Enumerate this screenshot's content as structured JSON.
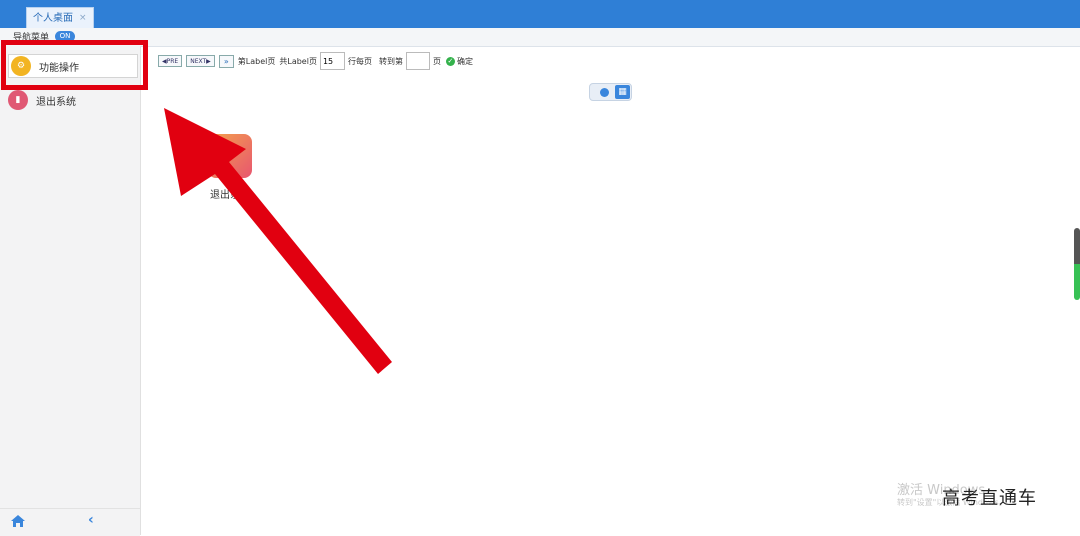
{
  "tabs": [
    {
      "label": "个人桌面",
      "close": "×"
    }
  ],
  "navbar": {
    "label": "导航菜单",
    "toggle": "ON"
  },
  "sidebar": {
    "items": [
      {
        "label": "功能操作",
        "icon": "gear-icon"
      },
      {
        "label": "退出系统",
        "icon": "chart-icon"
      }
    ],
    "bottom": {
      "home": "home-icon",
      "back": "chevron-left-icon"
    }
  },
  "pager": {
    "prev": "PRE",
    "next": "NEXT",
    "page_info": "第Label页",
    "total_info": "共Label页",
    "rows_value": "15",
    "rows_suffix": "行每页",
    "goto_prefix": "转到第",
    "goto_value": "",
    "goto_suffix": "页",
    "ok_label": "确定"
  },
  "view_toggle": {
    "list": "list-view-icon",
    "grid": "grid-view-icon"
  },
  "desktop": {
    "icons": [
      {
        "label": "退出系统"
      }
    ]
  },
  "overlay": {
    "watermark_line1": "激活 Windows",
    "watermark_line2": "转到\"设置\"以激活 Windows。",
    "brand": "高考直通车"
  },
  "colors": {
    "accent": "#2f7fd6",
    "highlight": "#e10010",
    "icon_orange": "#f2b422",
    "icon_pink": "#e05874"
  }
}
